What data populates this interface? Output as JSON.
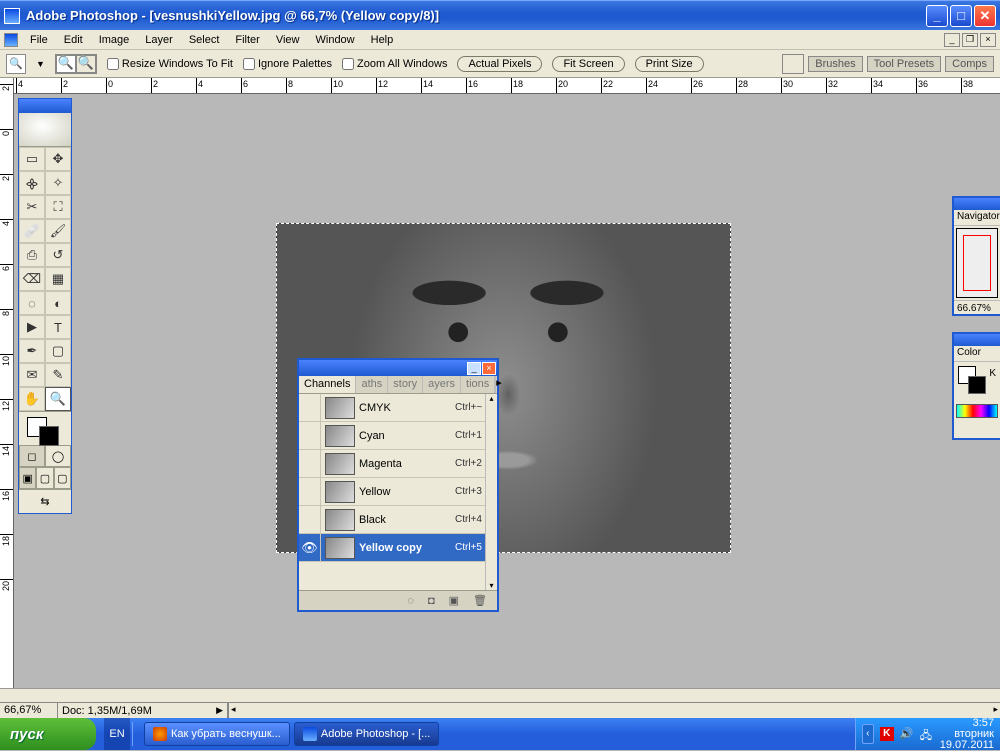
{
  "window": {
    "title": "Adobe Photoshop - [vesnushkiYellow.jpg @ 66,7% (Yellow copy/8)]"
  },
  "menu": {
    "items": [
      "File",
      "Edit",
      "Image",
      "Layer",
      "Select",
      "Filter",
      "View",
      "Window",
      "Help"
    ]
  },
  "options": {
    "resize_label": "Resize Windows To Fit",
    "ignore_label": "Ignore Palettes",
    "zoom_all_label": "Zoom All Windows",
    "actual_pixels": "Actual Pixels",
    "fit_screen": "Fit Screen",
    "print_size": "Print Size",
    "dock_tabs": [
      "Brushes",
      "Tool Presets",
      "Comps"
    ]
  },
  "ruler_h_labels": [
    "4",
    "2",
    "0",
    "2",
    "4",
    "6",
    "8",
    "10",
    "12",
    "14",
    "16",
    "18",
    "20",
    "22",
    "24",
    "26",
    "28",
    "30",
    "32",
    "34",
    "36",
    "38"
  ],
  "ruler_v_labels": [
    "2",
    "0",
    "2",
    "4",
    "6",
    "8",
    "10",
    "12",
    "14",
    "16",
    "18",
    "20"
  ],
  "navigator": {
    "tab": "Navigator",
    "zoom": "66.67%"
  },
  "color": {
    "tab": "Color",
    "k_label": "K"
  },
  "channels_panel": {
    "tabs": [
      "Channels",
      "aths",
      "story",
      "ayers",
      "tions"
    ],
    "active_tab": 0,
    "rows": [
      {
        "name": "CMYK",
        "shortcut": "Ctrl+~",
        "visible": false,
        "selected": false
      },
      {
        "name": "Cyan",
        "shortcut": "Ctrl+1",
        "visible": false,
        "selected": false
      },
      {
        "name": "Magenta",
        "shortcut": "Ctrl+2",
        "visible": false,
        "selected": false
      },
      {
        "name": "Yellow",
        "shortcut": "Ctrl+3",
        "visible": false,
        "selected": false
      },
      {
        "name": "Black",
        "shortcut": "Ctrl+4",
        "visible": false,
        "selected": false
      },
      {
        "name": "Yellow copy",
        "shortcut": "Ctrl+5",
        "visible": true,
        "selected": true
      }
    ]
  },
  "status": {
    "zoom": "66,67%",
    "doc": "Doc: 1,35M/1,69M"
  },
  "taskbar": {
    "start": "пуск",
    "lang": "EN",
    "tasks": [
      {
        "label": "Как убрать веснушк...",
        "icon": "ff",
        "active": false
      },
      {
        "label": "Adobe Photoshop - [...",
        "icon": "ps",
        "active": true
      }
    ],
    "clock": {
      "time": "3:57",
      "weekday": "вторник",
      "date": "19.07.2011"
    }
  }
}
